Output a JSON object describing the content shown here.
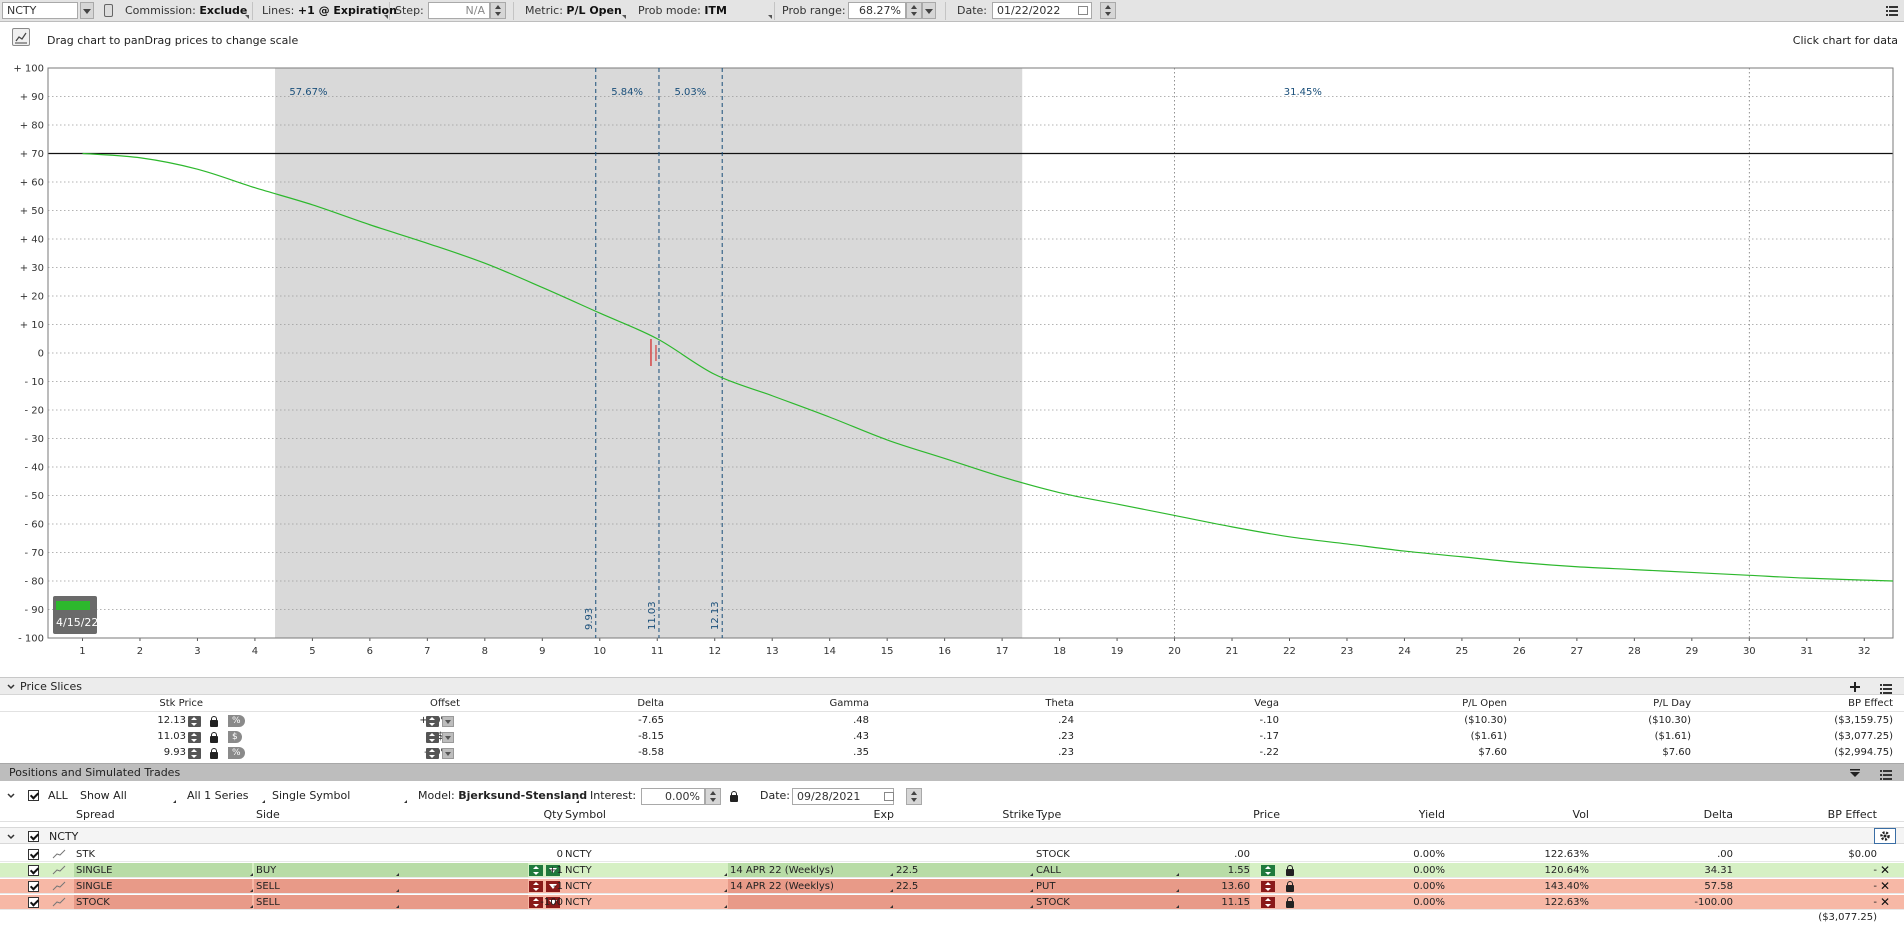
{
  "toolbar": {
    "symbol": "NCTY",
    "commission_label": "Commission:",
    "commission_value": "Exclude",
    "lines_label": "Lines:",
    "lines_value": "+1 @ Expiration",
    "step_label": "Step:",
    "step_value": "N/A",
    "metric_label": "Metric:",
    "metric_value": "P/L Open",
    "prob_mode_label": "Prob mode:",
    "prob_mode_value": "ITM",
    "prob_range_label": "Prob range:",
    "prob_range_value": "68.27%",
    "date_label": "Date:",
    "date_value": "01/22/2022"
  },
  "chart_header": {
    "hint_left": "Drag chart to panDrag prices to change scale",
    "hint_right": "Click chart for data"
  },
  "chart_data": {
    "type": "line",
    "x_range": [
      0.4,
      32.5
    ],
    "y_range": [
      -100,
      100
    ],
    "x_ticks": [
      "1",
      "2",
      "3",
      "4",
      "5",
      "6",
      "7",
      "8",
      "9",
      "10",
      "11",
      "12",
      "13",
      "14",
      "15",
      "16",
      "17",
      "18",
      "19",
      "20",
      "21",
      "22",
      "23",
      "24",
      "25",
      "26",
      "27",
      "28",
      "29",
      "30",
      "31",
      "32"
    ],
    "y_ticks": [
      "+ 100",
      "+ 90",
      "+ 80",
      "+ 70",
      "+ 60",
      "+ 50",
      "+ 40",
      "+ 30",
      "+ 20",
      "+ 10",
      "0",
      "- 10",
      "- 20",
      "- 30",
      "- 40",
      "- 50",
      "- 60",
      "- 70",
      "- 80",
      "- 90",
      "- 100"
    ],
    "y_tick_values": [
      100,
      90,
      80,
      70,
      60,
      50,
      40,
      30,
      20,
      10,
      0,
      -10,
      -20,
      -30,
      -40,
      -50,
      -60,
      -70,
      -80,
      -90,
      -100
    ],
    "reference_line_y": 70,
    "shaded_range": [
      4.35,
      17.35
    ],
    "vertical_dotted_x": [
      20,
      30
    ],
    "price_slices": [
      {
        "label": "9.93",
        "x": 9.93
      },
      {
        "label": "11.03",
        "x": 11.03
      },
      {
        "label": "12.13",
        "x": 12.13
      }
    ],
    "probabilities": [
      {
        "label": "57.67%",
        "x": 4.6
      },
      {
        "label": "5.84%",
        "x": 10.2
      },
      {
        "label": "5.03%",
        "x": 11.3
      },
      {
        "label": "31.45%",
        "x": 21.9
      }
    ],
    "current_price": 11.03,
    "series": [
      {
        "x": [
          1,
          2,
          3,
          4,
          5,
          6,
          7,
          8,
          9,
          10,
          11,
          12,
          13,
          14,
          15,
          16,
          17,
          18,
          19,
          20,
          21,
          22,
          23,
          24,
          25,
          26,
          27,
          28,
          29,
          30,
          31,
          32.5
        ],
        "values": [
          70,
          68.5,
          64.5,
          58,
          52,
          45,
          38.5,
          31.5,
          23,
          14,
          5,
          -7.5,
          -15,
          -22.5,
          -30.5,
          -37,
          -43.5,
          -49,
          -53,
          -57,
          -61,
          -64.5,
          -67,
          -69.5,
          -71.5,
          -73.5,
          -75,
          -76,
          -77,
          -78,
          -79,
          -80
        ],
        "color": "#2db82d"
      }
    ],
    "expiration_label": "4/15/22"
  },
  "price_slices": {
    "title": "Price Slices",
    "headers": [
      "Stk Price",
      "Offset",
      "Delta",
      "Gamma",
      "Theta",
      "Vega",
      "P/L Open",
      "P/L Day",
      "BP Effect"
    ],
    "rows": [
      {
        "price": "12.13",
        "unit": "%",
        "offset": "+10%",
        "delta": "-7.65",
        "gamma": ".48",
        "theta": ".24",
        "vega": "-.10",
        "pl_open": "($10.30)",
        "pl_day": "($10.30)",
        "bp": "($3,159.75)"
      },
      {
        "price": "11.03",
        "unit": "$",
        "offset": "$0",
        "delta": "-8.15",
        "gamma": ".43",
        "theta": ".23",
        "vega": "-.17",
        "pl_open": "($1.61)",
        "pl_day": "($1.61)",
        "bp": "($3,077.25)"
      },
      {
        "price": "9.93",
        "unit": "%",
        "offset": "-10%",
        "delta": "-8.58",
        "gamma": ".35",
        "theta": ".23",
        "vega": "-.22",
        "pl_open": "$7.60",
        "pl_day": "$7.60",
        "bp": "($2,994.75)"
      }
    ]
  },
  "positions": {
    "title": "Positions and Simulated Trades",
    "filter": {
      "all": "ALL",
      "show": "Show All",
      "series": "All 1 Series",
      "symbol_mode": "Single Symbol",
      "model_label": "Model:",
      "model_value": "Bjerksund-Stensland",
      "interest_label": "Interest:",
      "interest_value": "0.00%",
      "date_label": "Date:",
      "date_value": "09/28/2021"
    },
    "headers": [
      "Spread",
      "Side",
      "Qty",
      "Symbol",
      "Exp",
      "Strike",
      "Type",
      "Price",
      "Yield",
      "Vol",
      "Delta",
      "BP Effect"
    ],
    "group": "NCTY",
    "rows": [
      {
        "spread": "STK",
        "side": "",
        "qty": "0",
        "symbol": "NCTY",
        "exp": "",
        "strike": "",
        "type": "STOCK",
        "price": ".00",
        "yield": "0.00%",
        "vol": "122.63%",
        "delta": ".00",
        "bp": "$0.00",
        "style": "plain"
      },
      {
        "spread": "SINGLE",
        "side": "BUY",
        "qty": "+1",
        "symbol": "NCTY",
        "exp": "14 APR 22 (Weeklys)",
        "strike": "22.5",
        "type": "CALL",
        "price": "1.55",
        "yield": "0.00%",
        "vol": "120.64%",
        "delta": "34.31",
        "bp": "-",
        "style": "buy"
      },
      {
        "spread": "SINGLE",
        "side": "SELL",
        "qty": "-1",
        "symbol": "NCTY",
        "exp": "14 APR 22 (Weeklys)",
        "strike": "22.5",
        "type": "PUT",
        "price": "13.60",
        "yield": "0.00%",
        "vol": "143.40%",
        "delta": "57.58",
        "bp": "-",
        "style": "sell"
      },
      {
        "spread": "STOCK",
        "side": "SELL",
        "qty": "-100",
        "symbol": "NCTY",
        "exp": "",
        "strike": "",
        "type": "STOCK",
        "price": "11.15",
        "yield": "0.00%",
        "vol": "122.63%",
        "delta": "-100.00",
        "bp": "-",
        "style": "sell"
      }
    ],
    "total_bp": "($3,077.25)"
  },
  "colors": {
    "buy_row": "#d6f0c4",
    "buy_cell": "#b8dca6",
    "sell_row": "#f7b8a6",
    "sell_cell": "#e89a88",
    "shade": "#d9d9d9",
    "curve": "#2db82d",
    "prob_text": "#1a4f7a"
  }
}
